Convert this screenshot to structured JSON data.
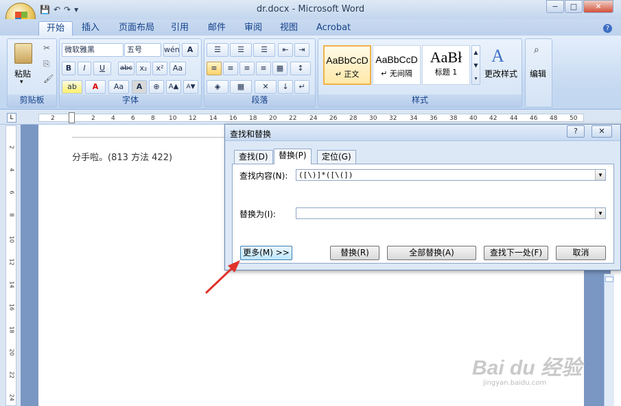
{
  "window": {
    "title": "dr.docx - Microsoft Word",
    "minimize": "−",
    "restore": "□",
    "close": "✕"
  },
  "qat": {
    "save": "💾",
    "undo": "↶",
    "redo": "↷",
    "more": "▾"
  },
  "tabs": [
    "开始",
    "插入",
    "页面布局",
    "引用",
    "邮件",
    "审阅",
    "视图",
    "Acrobat"
  ],
  "ribbon": {
    "clipboard": {
      "label": "剪贴板",
      "paste": "粘贴",
      "paste_arrow": "▾"
    },
    "font": {
      "label": "字体",
      "font_name": "微软雅黑",
      "font_size": "五号",
      "bold": "B",
      "italic": "I",
      "underline": "U",
      "strike": "abc",
      "subscript": "x₂",
      "superscript": "x²",
      "grow": "A▲",
      "shrink": "A▼",
      "case": "Aa",
      "highlight": "ab",
      "color": "A"
    },
    "paragraph": {
      "label": "段落"
    },
    "styles": {
      "label": "样式",
      "items": [
        {
          "preview": "AaBbCcD",
          "name": "↵ 正文"
        },
        {
          "preview": "AaBbCcD",
          "name": "↵ 无间隔"
        },
        {
          "preview": "AaBł",
          "name": "标题 1"
        }
      ],
      "change": "更改样式"
    },
    "editing": {
      "label": "编辑"
    }
  },
  "ruler": {
    "marks": [
      "2",
      "2",
      "4",
      "6",
      "8",
      "10",
      "12",
      "14",
      "16",
      "18",
      "20",
      "22",
      "24",
      "26",
      "28",
      "30",
      "32",
      "34",
      "36",
      "38",
      "40",
      "42",
      "44",
      "46",
      "48",
      "50"
    ],
    "vmarks": [
      "2",
      "4",
      "6",
      "8",
      "10",
      "12",
      "14",
      "16",
      "18",
      "20",
      "22",
      "24"
    ]
  },
  "document": {
    "text": "分手啦。(813 方法 422)"
  },
  "dialog": {
    "title": "查找和替换",
    "help": "?",
    "close": "✕",
    "tabs": [
      "查找(D)",
      "替换(P)",
      "定位(G)"
    ],
    "find_label": "查找内容(N):",
    "find_value": "([\\)]*([\\(])",
    "replace_label": "替换为(I):",
    "replace_value": "",
    "more": "更多(M) >>",
    "replace": "替换(R)",
    "replace_all": "全部替换(A)",
    "find_next": "查找下一处(F)",
    "cancel": "取消"
  },
  "watermark": {
    "brand": "Bai du 经验",
    "url": "jingyan.baidu.com"
  },
  "colors": {
    "accent": "#15428b",
    "ribbon": "#c5d9f1",
    "arrow": "#e0322b"
  }
}
